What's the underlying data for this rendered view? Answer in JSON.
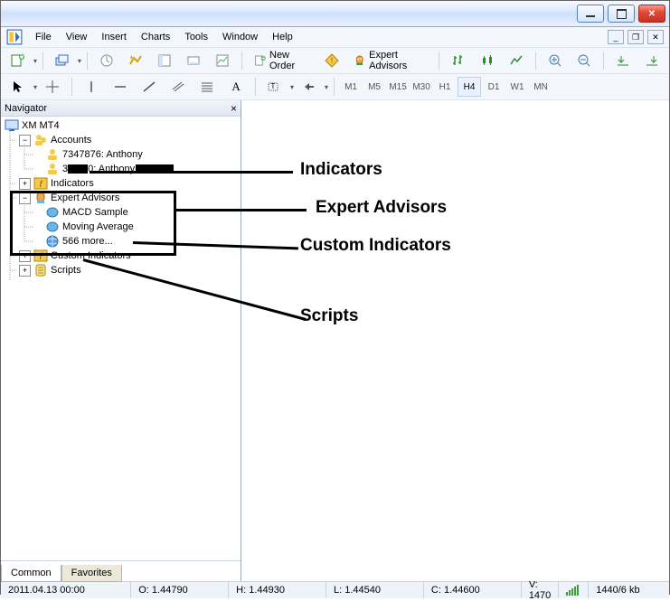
{
  "menu": {
    "file": "File",
    "view": "View",
    "insert": "Insert",
    "charts": "Charts",
    "tools": "Tools",
    "window": "Window",
    "help": "Help"
  },
  "toolbar": {
    "new_order": "New Order",
    "expert_advisors": "Expert Advisors"
  },
  "timeframes": [
    "M1",
    "M5",
    "M15",
    "M30",
    "H1",
    "H4",
    "D1",
    "W1",
    "MN"
  ],
  "timeframe_selected": "H4",
  "navigator": {
    "title": "Navigator",
    "root": "XM MT4",
    "accounts": "Accounts",
    "account1": "7347876: Anthony",
    "account2_prefix": "3",
    "account2_suffix": "0: Anthony",
    "indicators": "Indicators",
    "expert_advisors": "Expert Advisors",
    "ea1": "MACD Sample",
    "ea2": "Moving Average",
    "ea_more": "566 more...",
    "custom_indicators": "Custom Indicators",
    "scripts": "Scripts",
    "tab_common": "Common",
    "tab_favorites": "Favorites"
  },
  "callouts": {
    "indicators": "Indicators",
    "ea": "Expert Advisors",
    "ci": "Custom Indicators",
    "scripts": "Scripts"
  },
  "status": {
    "date": "2011.04.13 00:00",
    "open": "O: 1.44790",
    "high": "H: 1.44930",
    "low": "L: 1.44540",
    "close": "C: 1.44600",
    "vol": "V: 1470",
    "conn": "1440/6 kb"
  }
}
